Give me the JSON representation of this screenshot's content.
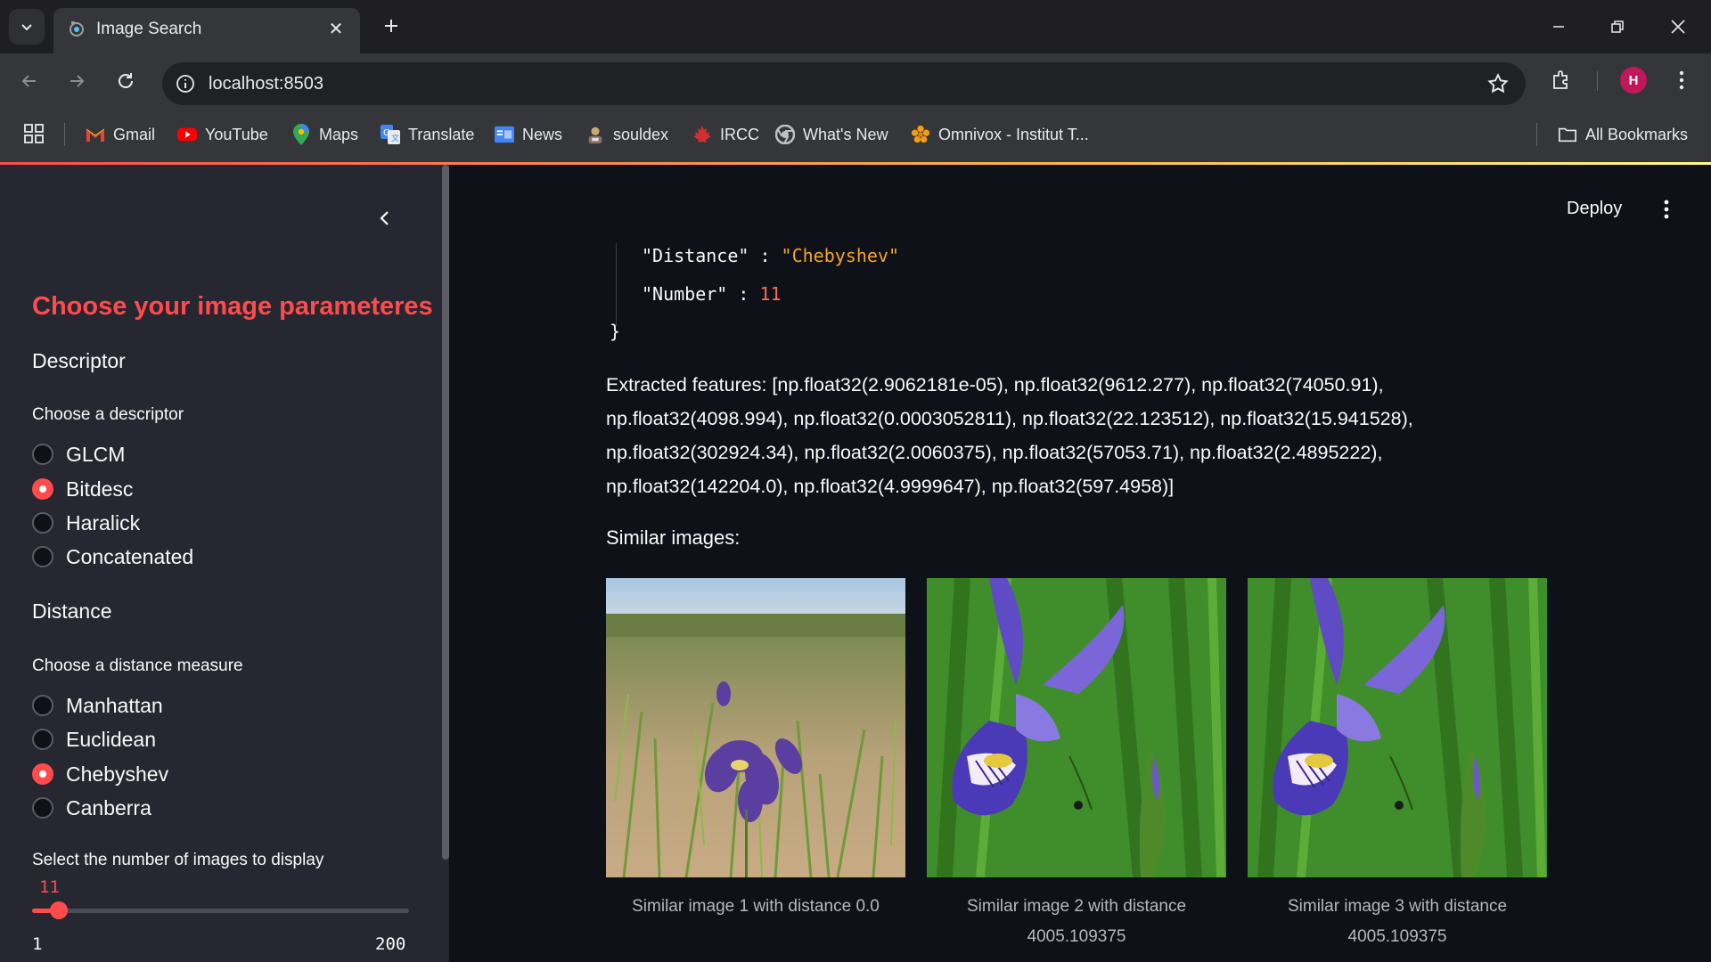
{
  "browser": {
    "tab_title": "Image Search",
    "url": "localhost:8503",
    "profile_initial": "H",
    "bookmarks": [
      {
        "label": "Gmail",
        "icon": "gmail-icon"
      },
      {
        "label": "YouTube",
        "icon": "youtube-icon"
      },
      {
        "label": "Maps",
        "icon": "maps-icon"
      },
      {
        "label": "Translate",
        "icon": "translate-icon"
      },
      {
        "label": "News",
        "icon": "news-icon"
      },
      {
        "label": "souldex",
        "icon": "souldex-icon"
      },
      {
        "label": "IRCC",
        "icon": "ircc-icon"
      },
      {
        "label": "What's New",
        "icon": "chrome-icon"
      },
      {
        "label": "Omnivox - Institut T...",
        "icon": "omnivox-icon"
      }
    ],
    "all_bookmarks": "All Bookmarks"
  },
  "sidebar": {
    "title": "Choose your image parameteres",
    "descriptor": {
      "heading": "Descriptor",
      "label": "Choose a descriptor",
      "options": [
        "GLCM",
        "Bitdesc",
        "Haralick",
        "Concatenated"
      ],
      "selected": "Bitdesc"
    },
    "distance": {
      "heading": "Distance",
      "label": "Choose a distance measure",
      "options": [
        "Manhattan",
        "Euclidean",
        "Chebyshev",
        "Canberra"
      ],
      "selected": "Chebyshev"
    },
    "slider": {
      "label": "Select the number of images to display",
      "value": "11",
      "min": "1",
      "max": "200"
    }
  },
  "main": {
    "deploy_label": "Deploy",
    "json_view": {
      "lines": [
        {
          "key": "\"Distance\"",
          "value": "\"Chebyshev\"",
          "type": "string"
        },
        {
          "key": "\"Number\"",
          "value": "11",
          "type": "number"
        }
      ],
      "closing_brace": "}"
    },
    "features_text": "Extracted features: [np.float32(2.9062181e-05), np.float32(9612.277), np.float32(74050.91), np.float32(4098.994), np.float32(0.0003052811), np.float32(22.123512), np.float32(15.941528), np.float32(302924.34), np.float32(2.0060375), np.float32(57053.71), np.float32(2.4895222), np.float32(142204.0), np.float32(4.9999647), np.float32(597.4958)]",
    "similar_heading": "Similar images:",
    "results": [
      {
        "caption": "Similar image 1 with distance 0.0",
        "image": "iris-field-photo"
      },
      {
        "caption": "Similar image 2 with distance 4005.109375",
        "image": "iris-closeup-photo"
      },
      {
        "caption": "Similar image 3 with distance 4005.109375",
        "image": "iris-closeup-photo"
      }
    ]
  },
  "colors": {
    "accent": "#ff4b4b",
    "sidebar_bg": "#262730",
    "main_bg": "#0e1117",
    "json_string": "#f5a623",
    "json_number": "#ff6b5b"
  }
}
